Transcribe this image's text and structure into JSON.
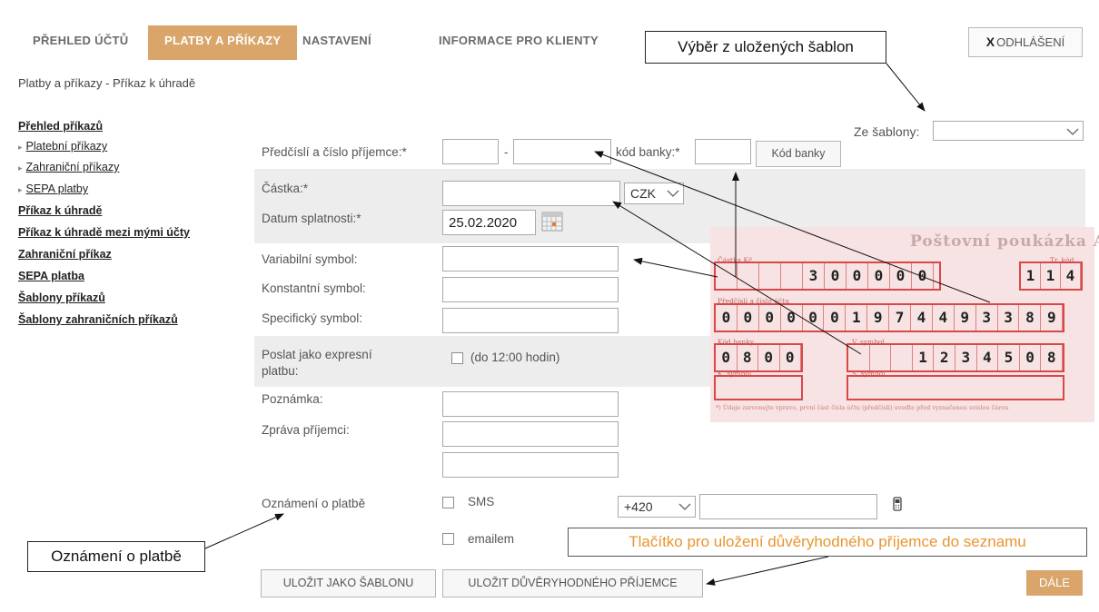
{
  "nav": {
    "tabs": [
      {
        "label": "PŘEHLED ÚČTŮ"
      },
      {
        "label": "PLATBY A PŘÍKAZY"
      },
      {
        "label": "NASTAVENÍ"
      },
      {
        "label": "INFORMACE PRO KLIENTY"
      }
    ],
    "logout_x": "X",
    "logout_label": "ODHLÁŠENÍ",
    "accent_color": "#d9a56a"
  },
  "breadcrumb": "Platby a příkazy - Příkaz k úhradě",
  "sidebar": {
    "items": [
      {
        "label": "Přehled příkazů"
      },
      {
        "label": "Platební příkazy"
      },
      {
        "label": "Zahraniční příkazy"
      },
      {
        "label": "SEPA platby"
      },
      {
        "label": "Příkaz k úhradě"
      },
      {
        "label": "Příkaz k úhradě mezi mými účty"
      },
      {
        "label": "Zahraniční příkaz"
      },
      {
        "label": "SEPA platba"
      },
      {
        "label": "Šablony příkazů"
      },
      {
        "label": "Šablony zahraničních příkazů"
      }
    ]
  },
  "form": {
    "template_label": "Ze šablony:",
    "template_value": "",
    "recipient_label": "Předčíslí a číslo příjemce:*",
    "recipient_prefix": "",
    "recipient_separator": "-",
    "recipient_number": "",
    "bank_code_label": "kód banky:*",
    "bank_code_value": "",
    "bank_code_button": "Kód banky",
    "amount_label": "Částka:*",
    "amount_value": "",
    "currency": "CZK",
    "due_date_label": "Datum splatnosti:*",
    "due_date_value": "25.02.2020",
    "variable_symbol_label": "Variabilní symbol:",
    "constant_symbol_label": "Konstantní symbol:",
    "specific_symbol_label": "Specifický symbol:",
    "express_label_line1": "Poslat jako expresní",
    "express_label_line2": "platbu:",
    "express_note": "(do 12:00 hodin)",
    "note_label": "Poznámka:",
    "message_label": "Zpráva příjemci:",
    "notification_label": "Oznámení o platbě",
    "sms_label": "SMS",
    "phone_prefix": "+420",
    "phone_value": "",
    "email_label": "emailem",
    "save_template_button": "ULOŽIT JAKO ŠABLONU",
    "save_trusted_button": "ULOŽIT DŮVĚRYHODNÉHO PŘÍJEMCE",
    "next_button": "DÁLE"
  },
  "callouts": {
    "template": "Výběr z uložených šablon",
    "notification": "Oznámení o platbě",
    "trusted": "Tlačítko pro uložení důvěryhodného příjemce do seznamu",
    "trusted_color": "#e8952f"
  },
  "poukazka": {
    "title": "Poštovní poukázka A",
    "amount_caption": "Částka Kč",
    "amount_digits": [
      "",
      "",
      "",
      "",
      "3",
      "0",
      "0",
      "0",
      "0",
      "0"
    ],
    "code_caption": "Tr. kód",
    "code_digits": [
      "1",
      "1",
      "4"
    ],
    "account_caption": "Předčíslí a číslo účtu",
    "account_digits": [
      "0",
      "0",
      "0",
      "0",
      "0",
      "0",
      "1",
      "9",
      "7",
      "4",
      "4",
      "9",
      "3",
      "3",
      "8",
      "9"
    ],
    "bank_caption": "Kód banky",
    "bank_digits": [
      "0",
      "8",
      "0",
      "0"
    ],
    "vs_caption": "V. symbol",
    "vs_digits": [
      "",
      "",
      "",
      "1",
      "2",
      "3",
      "4",
      "5",
      "0",
      "8"
    ],
    "ks_caption": "K. symbol",
    "ss_caption": "S. symbol",
    "footnote": "*) Údaje zarovnejte vpravo, první část čísla účtu (předčíslí) uveďte před vyznačenou svislou čárou"
  }
}
